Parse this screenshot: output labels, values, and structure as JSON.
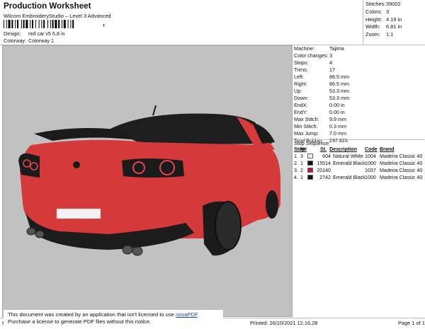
{
  "header": {
    "title": "Production Worksheet",
    "subtitle": "Wilcom EmbroideryStudio – Level 3 Advanced",
    "comma": ","
  },
  "meta": [
    {
      "key": "Design:",
      "value": "red car v5 6,8 in"
    },
    {
      "key": "Colorway:",
      "value": "Colorway 1"
    }
  ],
  "summary": [
    {
      "key": "Stitches:",
      "value": "39002"
    },
    {
      "key": "Colors:",
      "value": "3"
    },
    {
      "key": "Height:",
      "value": "4.19 in"
    },
    {
      "key": "Width:",
      "value": "6.81 in"
    },
    {
      "key": "Zoom:",
      "value": "1:1"
    }
  ],
  "machine_info": [
    {
      "key": "Machine:",
      "value": "Tajima"
    },
    {
      "key": "Color changes:",
      "value": "3"
    },
    {
      "key": "Stops:",
      "value": "4"
    },
    {
      "key": "Trims:",
      "value": "17"
    },
    {
      "key": "Left:",
      "value": "86.5 mm"
    },
    {
      "key": "Right:",
      "value": "86.5 mm"
    },
    {
      "key": "Up:",
      "value": "53.3 mm"
    },
    {
      "key": "Down:",
      "value": "53.3 mm"
    },
    {
      "key": "EndX:",
      "value": "0.00 in"
    },
    {
      "key": "EndY:",
      "value": "0.00 in"
    },
    {
      "key": "Max Stitch:",
      "value": "9.9 mm"
    },
    {
      "key": "Min Stitch:",
      "value": "0.3 mm"
    },
    {
      "key": "Max Jump:",
      "value": "7.0 mm"
    },
    {
      "key": "Total Bobbin:",
      "value": "297.82ft"
    }
  ],
  "stop_sequence": {
    "title": "Stop Sequence:",
    "headers": [
      "Stop",
      "N#",
      "",
      "St.",
      "Description",
      "Code",
      "Brand"
    ],
    "rows": [
      {
        "stop": "1.",
        "n": "3",
        "color": "#eeeeee",
        "st": "604",
        "desc": "Natural White",
        "code": "1004",
        "brand": "Madeira Classic 40"
      },
      {
        "stop": "2.",
        "n": "1",
        "color": "#111111",
        "st": "15514",
        "desc": "Emerald Black",
        "code": "1000",
        "brand": "Madeira Classic 40"
      },
      {
        "stop": "3.",
        "n": "2",
        "color": "#c8102e",
        "st": "20140",
        "desc": "",
        "code": "1037",
        "brand": "Madeira Classic 40"
      },
      {
        "stop": "4.",
        "n": "1",
        "color": "#111111",
        "st": "2742",
        "desc": "Emerald Black",
        "code": "1000",
        "brand": "Madeira Classic 40"
      }
    ]
  },
  "notice": {
    "line1": "This document was created by an application that isn't licensed to use ",
    "link": "novaPDF",
    "line1_end": ".",
    "line2": "Purchase a license to generate PDF files without this notice."
  },
  "footer": {
    "cr": "Cr",
    "printed": "Printed: 26/10/2021 12.16.28",
    "page": "Page 1 of 1"
  },
  "colors": {
    "design_bg": "#c1c1c1",
    "car_body": "#d63a3a",
    "car_dark": "#1b1b1b",
    "link": "#1a3cc7"
  }
}
